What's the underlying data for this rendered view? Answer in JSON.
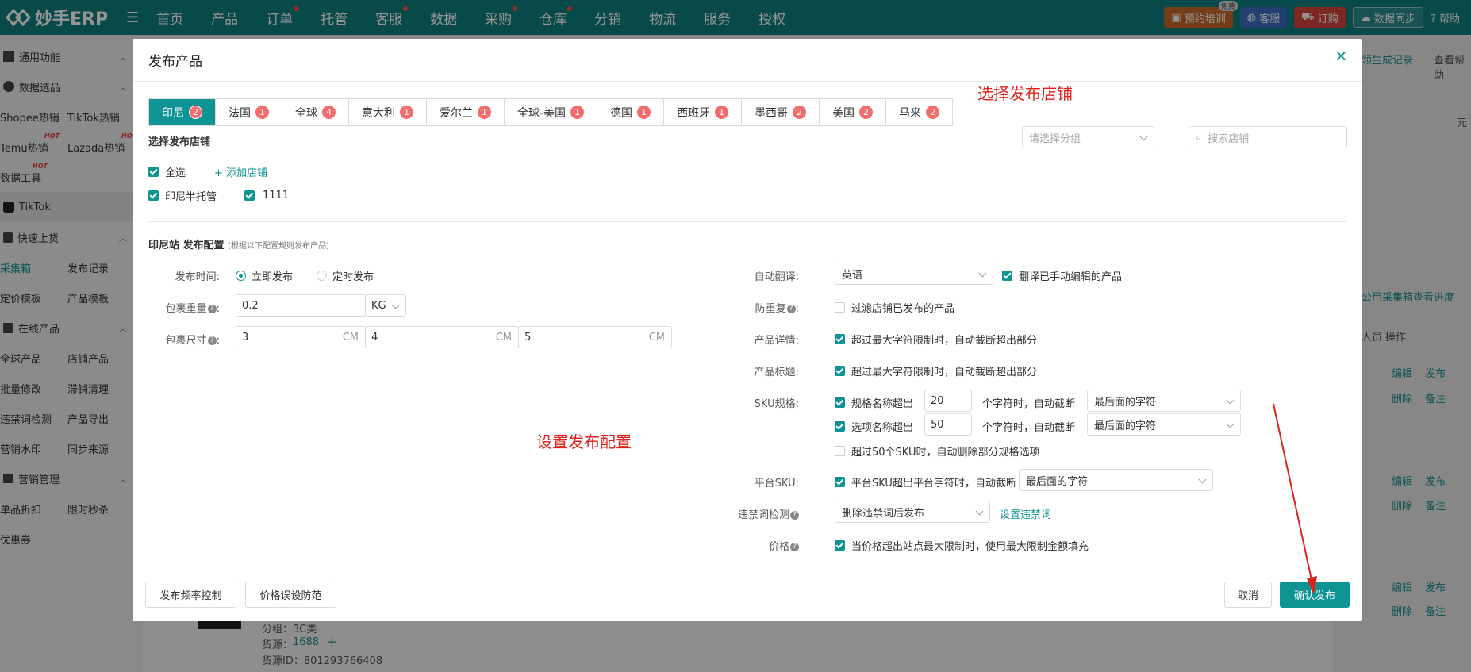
{
  "app": {
    "logo_text": "妙手ERP",
    "nav": [
      {
        "label": "首页",
        "dot": false
      },
      {
        "label": "产品",
        "dot": false
      },
      {
        "label": "订单",
        "dot": true
      },
      {
        "label": "托管",
        "dot": false
      },
      {
        "label": "客服",
        "dot": true
      },
      {
        "label": "数据",
        "dot": false
      },
      {
        "label": "采购",
        "dot": true
      },
      {
        "label": "仓库",
        "dot": true
      },
      {
        "label": "分销",
        "dot": false
      },
      {
        "label": "物流",
        "dot": false
      },
      {
        "label": "服务",
        "dot": false
      },
      {
        "label": "授权",
        "dot": false
      }
    ],
    "top_right": {
      "training": "预约培训",
      "free_tag": "免费",
      "service": "客服",
      "order": "订购",
      "sync": "数据同步",
      "help": "帮助"
    }
  },
  "sidebar": {
    "group_common": "通用功能",
    "group_data": "数据选品",
    "row1": [
      "Shopee热销",
      "TikTok热销"
    ],
    "row2": [
      "Temu热销",
      "Lazada热销"
    ],
    "row3": [
      "数据工具"
    ],
    "hot_tag": "HOT",
    "tiktok": "TikTok",
    "group_upload": "快速上货",
    "row4": [
      "采集箱",
      "发布记录"
    ],
    "row5": [
      "定价模板",
      "产品模板"
    ],
    "group_online": "在线产品",
    "row6": [
      "全球产品",
      "店铺产品"
    ],
    "row7": [
      "批量修改",
      "滞销清理"
    ],
    "row8": [
      "违禁词检测",
      "产品导出"
    ],
    "row9": [
      "营销水印",
      "同步来源"
    ],
    "group_marketing": "营销管理",
    "row10": [
      "单品折扣",
      "限时秒杀"
    ],
    "row11": [
      "优惠券"
    ]
  },
  "background": {
    "gen_record": "领生成记录",
    "view_help": "查看帮助",
    "yuan": "元",
    "progress_link": "公用采集箱查看进度",
    "col_staff": "人员",
    "col_action": "操作",
    "edit": "编辑",
    "publish": "发布",
    "delete": "删除",
    "note": "备注",
    "group_line": "分组：3C类",
    "source_label": "货源：",
    "source_val": "1688",
    "source_id": "货源ID：801293766408"
  },
  "modal": {
    "title": "发布产品",
    "annotation_store": "选择发布店铺",
    "annotation_config": "设置发布配置",
    "tabs": [
      {
        "label": "印尼",
        "count": "2",
        "active": true
      },
      {
        "label": "法国",
        "count": "1",
        "active": false
      },
      {
        "label": "全球",
        "count": "4",
        "active": false
      },
      {
        "label": "意大利",
        "count": "1",
        "active": false
      },
      {
        "label": "爱尔兰",
        "count": "1",
        "active": false
      },
      {
        "label": "全球-美国",
        "count": "1",
        "active": false
      },
      {
        "label": "德国",
        "count": "1",
        "active": false
      },
      {
        "label": "西班牙",
        "count": "1",
        "active": false
      },
      {
        "label": "墨西哥",
        "count": "2",
        "active": false
      },
      {
        "label": "美国",
        "count": "2",
        "active": false
      },
      {
        "label": "马来",
        "count": "2",
        "active": false
      }
    ],
    "store_section_title": "选择发布店铺",
    "group_select_placeholder": "请选择分组",
    "store_search_placeholder": "搜索店铺",
    "select_all": "全选",
    "add_store": "+ 添加店铺",
    "stores": [
      "印尼半托管",
      "1111"
    ],
    "config_title": "印尼站 发布配置",
    "config_sub": "(根据以下配置规则发布产品)",
    "publish_time_label": "发布时间:",
    "publish_now": "立即发布",
    "publish_scheduled": "定时发布",
    "weight_label": "包裹重量",
    "weight_value": "0.2",
    "weight_unit": "KG",
    "size_label": "包裹尺寸",
    "size_values": [
      "3",
      "4",
      "5"
    ],
    "size_unit": "CM",
    "auto_translate_label": "自动翻译:",
    "translate_lang": "英语",
    "translate_manual": "翻译已手动编辑的产品",
    "dedupe_label": "防重复",
    "dedupe_text": "过滤店铺已发布的产品",
    "detail_label": "产品详情:",
    "detail_text": "超过最大字符限制时，自动截断超出部分",
    "title_label": "产品标题:",
    "title_text": "超过最大字符限制时，自动截断超出部分",
    "sku_label": "SKU规格:",
    "sku_name_text": "规格名称超出",
    "sku_name_val": "20",
    "sku_option_text": "选项名称超出",
    "sku_option_val": "50",
    "sku_chars_text": "个字符时，自动截断",
    "sku_trunc_option": "最后面的字符",
    "sku_over50": "超过50个SKU时，自动删除部分规格选项",
    "platform_sku_label": "平台SKU:",
    "platform_sku_text": "平台SKU超出平台字符时，自动截断",
    "platform_sku_option": "最后面的字符",
    "banned_label": "违禁词检测",
    "banned_option": "删除违禁词后发布",
    "banned_link": "设置违禁词",
    "price_label": "价格",
    "price_text": "当价格超出站点最大限制时，使用最大限制金额填充",
    "btn_freq": "发布频率控制",
    "btn_price_guard": "价格误设防范",
    "btn_cancel": "取消",
    "btn_confirm": "确认发布"
  }
}
